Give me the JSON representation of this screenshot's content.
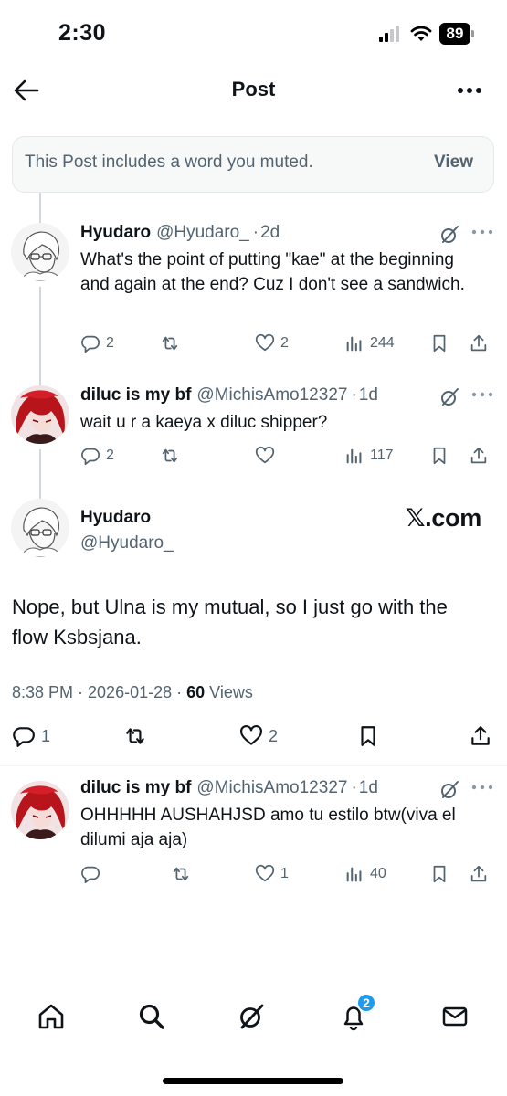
{
  "status_bar": {
    "time": "2:30",
    "battery": "89",
    "icons": [
      "cellular-signal-icon",
      "wifi-icon",
      "battery-icon"
    ]
  },
  "header": {
    "title": "Post",
    "back_icon": "arrow-left-icon",
    "more_icon": "ellipsis-icon"
  },
  "muted_banner": {
    "text": "This Post includes a word you muted.",
    "action": "View"
  },
  "replies_above": [
    {
      "display_name": "Hyudaro",
      "handle": "@Hyudaro_",
      "time": "2d",
      "text": "What's the point of putting \"kae\" at the beginning and again at the end? Cuz I don't see a sandwich.",
      "replies": "2",
      "reposts": "",
      "likes": "2",
      "views": "244"
    },
    {
      "display_name": "diluc is my bf",
      "handle": "@MichisAmo12327",
      "time": "1d",
      "text": "wait u r a kaeya x diluc shipper?",
      "replies": "2",
      "reposts": "",
      "likes": "",
      "views": "117"
    }
  ],
  "main_post": {
    "display_name": "Hyudaro",
    "handle": "@Hyudaro_",
    "watermark": "𝕏.com",
    "text": "Nope, but Ulna is my mutual, so I just go with the flow Ksbsjana.",
    "timestamp": "8:38 PM · 2026-01-28 · ",
    "views_count": "60",
    "views_label": " Views",
    "replies": "1",
    "reposts": "",
    "likes": "2"
  },
  "replies_below": [
    {
      "display_name": "diluc is my bf",
      "handle": "@MichisAmo12327",
      "time": "1d",
      "text": "OHHHHH AUSHAHJSD amo tu estilo btw(viva el dilumi aja aja)",
      "replies": "",
      "reposts": "",
      "likes": "1",
      "views": "40"
    }
  ],
  "bottom_nav": {
    "items": [
      "home-icon",
      "search-icon",
      "grok-icon",
      "notifications-icon",
      "messages-icon"
    ],
    "notification_badge": "2"
  },
  "colors": {
    "text": "#0f1419",
    "secondary": "#536471",
    "accent": "#1d9bf0",
    "thread_line": "#cfd9de"
  }
}
